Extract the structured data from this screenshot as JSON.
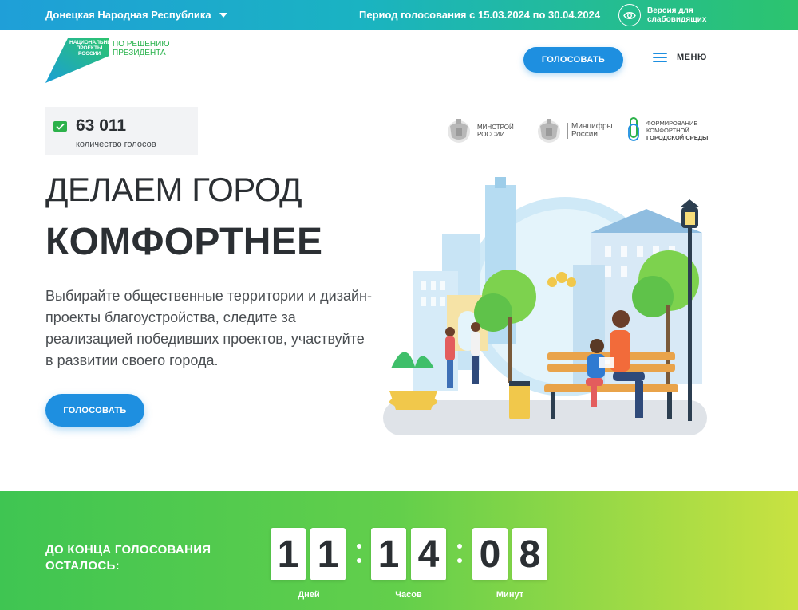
{
  "topbar": {
    "region": "Донецкая Народная Республика",
    "period": "Период голосования с 15.03.2024 по 30.04.2024",
    "a11y_line1": "Версия для",
    "a11y_line2": "слабовидящих"
  },
  "logo": {
    "national_line1": "НАЦИОНАЛЬНЫЕ",
    "national_line2": "ПРОЕКТЫ",
    "national_line3": "РОССИИ",
    "president_line1": "ПО РЕШЕНИЮ",
    "president_line2": "ПРЕЗИДЕНТА"
  },
  "header": {
    "vote_label": "ГОЛОСОВАТЬ",
    "menu_label": "МЕНЮ"
  },
  "counter": {
    "value": "63 011",
    "label": "количество голосов"
  },
  "partners": {
    "minstroy_line1": "МИНСТРОЙ",
    "minstroy_line2": "РОССИИ",
    "mintsifry_line1": "Минцифры",
    "mintsifry_line2": "России",
    "fks_line1": "ФОРМИРОВАНИЕ",
    "fks_line2": "КОМФОРТНОЙ",
    "fks_line3": "ГОРОДСКОЙ СРЕДЫ"
  },
  "hero": {
    "line1": "ДЕЛАЕМ ГОРОД",
    "line2": "КОМФОРТНЕЕ",
    "description": "Выбирайте общественные территории и дизайн-проекты благоустройства, следите за реализацией победивших проектов, участвуйте в развитии своего города.",
    "vote_label": "ГОЛОСОВАТЬ"
  },
  "countdown": {
    "label": "ДО КОНЦА ГОЛОСОВАНИЯ ОСТАЛОСЬ:",
    "days": [
      "1",
      "1"
    ],
    "hours": [
      "1",
      "4"
    ],
    "minutes": [
      "0",
      "8"
    ],
    "days_label": "Дней",
    "hours_label": "Часов",
    "minutes_label": "Минут"
  },
  "colors": {
    "accent": "#1e8fe0",
    "green": "#2cb14a"
  }
}
